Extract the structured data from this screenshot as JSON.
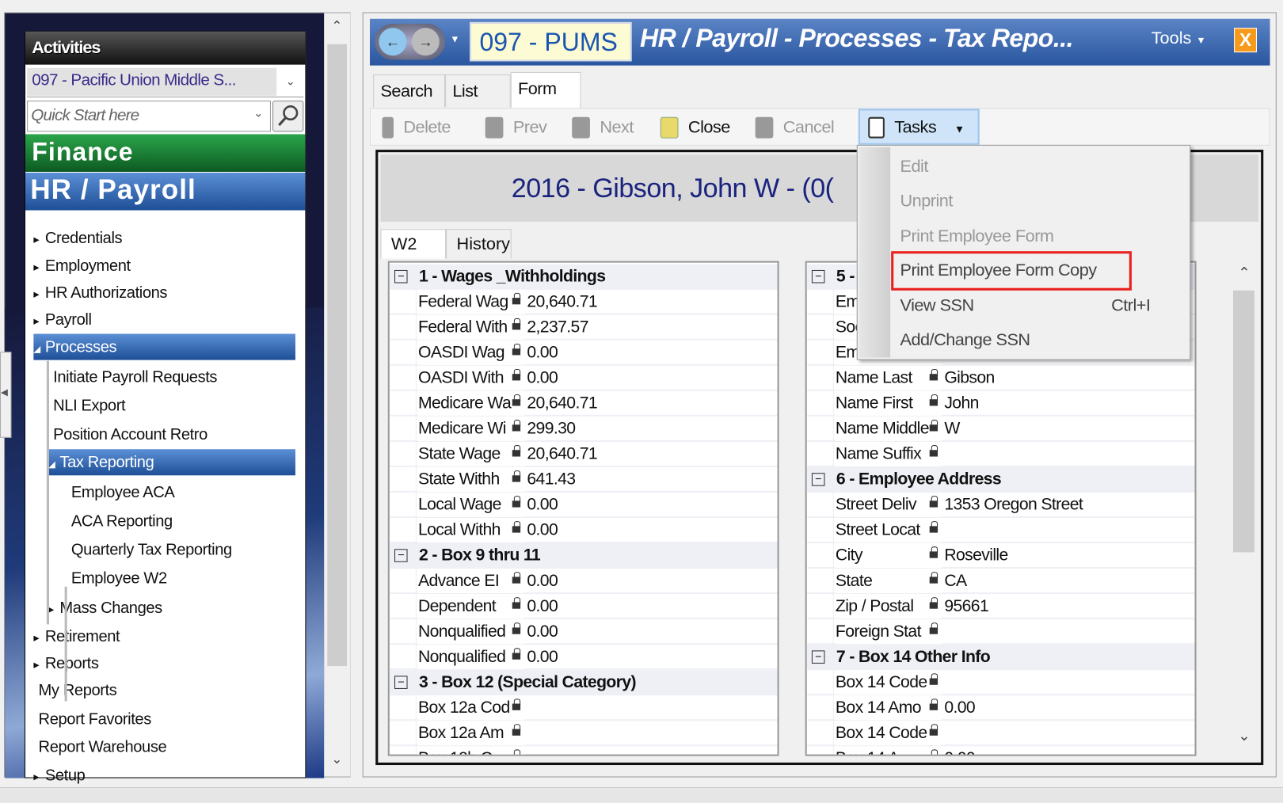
{
  "sidebar": {
    "header": "Activities",
    "district": "097 - Pacific Union Middle S...",
    "quick_start_placeholder": "Quick Start here",
    "modules": {
      "finance": "Finance",
      "hr_payroll": "HR / Payroll"
    },
    "tree": [
      {
        "label": "Credentials",
        "level": 0,
        "arrow": "right"
      },
      {
        "label": "Employment",
        "level": 0,
        "arrow": "right"
      },
      {
        "label": "HR Authorizations",
        "level": 0,
        "arrow": "right"
      },
      {
        "label": "Payroll",
        "level": 0,
        "arrow": "right"
      },
      {
        "label": "Processes",
        "level": 0,
        "arrow": "open",
        "selected": true
      },
      {
        "label": "Initiate Payroll Requests",
        "level": 1
      },
      {
        "label": "NLI Export",
        "level": 1
      },
      {
        "label": "Position Account Retro",
        "level": 1
      },
      {
        "label": "Tax Reporting",
        "level": 1,
        "arrow": "open",
        "selected": true
      },
      {
        "label": "Employee ACA",
        "level": 2
      },
      {
        "label": "ACA Reporting",
        "level": 2
      },
      {
        "label": "Quarterly Tax Reporting",
        "level": 2
      },
      {
        "label": "Employee W2",
        "level": 2
      },
      {
        "label": "Mass Changes",
        "level": 1,
        "arrow": "right"
      },
      {
        "label": "Retirement",
        "level": 0,
        "arrow": "right"
      },
      {
        "label": "Reports",
        "level": 0,
        "arrow": "right"
      },
      {
        "label": "My Reports",
        "level": 0
      },
      {
        "label": "Report Favorites",
        "level": 0
      },
      {
        "label": "Report Warehouse",
        "level": 0
      },
      {
        "label": "Setup",
        "level": 0,
        "arrow": "right"
      }
    ]
  },
  "window": {
    "org_code": "097 - PUMS",
    "title": "HR / Payroll - Processes - Tax Repo...",
    "tools_label": "Tools",
    "close_label": "X",
    "tabs": [
      "Search",
      "List",
      "Form"
    ],
    "active_tab": "Form"
  },
  "toolbar": {
    "delete": "Delete",
    "prev": "Prev",
    "next": "Next",
    "close": "Close",
    "cancel": "Cancel",
    "tasks": "Tasks"
  },
  "form": {
    "title": "2016 - Gibson, John W - (0(",
    "subtabs": [
      "W2",
      "History"
    ],
    "left_grid": [
      {
        "section": "1 - Wages _Withholdings"
      },
      {
        "label": "Federal Wag",
        "value": "20,640.71"
      },
      {
        "label": "Federal With",
        "value": "2,237.57"
      },
      {
        "label": "OASDI Wag",
        "value": "0.00"
      },
      {
        "label": "OASDI With",
        "value": "0.00"
      },
      {
        "label": "Medicare Wa",
        "value": "20,640.71"
      },
      {
        "label": "Medicare Wi",
        "value": "299.30"
      },
      {
        "label": "State Wage",
        "value": "20,640.71"
      },
      {
        "label": "State Withh",
        "value": "641.43"
      },
      {
        "label": "Local Wage",
        "value": "0.00"
      },
      {
        "label": "Local Withh",
        "value": "0.00"
      },
      {
        "section": "2 - Box 9 thru 11"
      },
      {
        "label": "Advance EI",
        "value": "0.00"
      },
      {
        "label": "Dependent",
        "value": "0.00"
      },
      {
        "label": "Nonqualified",
        "value": "0.00"
      },
      {
        "label": "Nonqualified",
        "value": "0.00"
      },
      {
        "section": "3 - Box 12 (Special Category)"
      },
      {
        "label": "Box 12a Cod",
        "value": ""
      },
      {
        "label": "Box 12a Am",
        "value": ""
      },
      {
        "label": "Box 12b C",
        "value": ""
      }
    ],
    "right_grid": [
      {
        "section": "5 -"
      },
      {
        "label": "Em",
        "value": ""
      },
      {
        "label": "Soc",
        "value": ""
      },
      {
        "label": "Em",
        "value": ""
      },
      {
        "label": "Name Last",
        "value": "Gibson"
      },
      {
        "label": "Name First",
        "value": "John"
      },
      {
        "label": "Name Middle",
        "value": "W"
      },
      {
        "label": "Name Suffix",
        "value": ""
      },
      {
        "section": "6 - Employee Address"
      },
      {
        "label": "Street Deliv",
        "value": "1353 Oregon Street"
      },
      {
        "label": "Street Locat",
        "value": ""
      },
      {
        "label": "City",
        "value": "Roseville"
      },
      {
        "label": "State",
        "value": "CA"
      },
      {
        "label": "Zip / Postal",
        "value": "95661"
      },
      {
        "label": "Foreign Stat",
        "value": ""
      },
      {
        "section": "7 - Box 14 Other Info"
      },
      {
        "label": "Box 14 Code",
        "value": ""
      },
      {
        "label": "Box 14 Amo",
        "value": "0.00"
      },
      {
        "label": "Box 14 Code",
        "value": ""
      },
      {
        "label": "Box 14 A",
        "value": "0.00"
      }
    ]
  },
  "tasks_menu": {
    "items": [
      {
        "label": "Edit",
        "disabled": true
      },
      {
        "label": "Unprint",
        "disabled": true
      },
      {
        "label": "Print Employee Form",
        "disabled": true
      },
      {
        "label": "Print Employee Form Copy",
        "highlighted": true
      },
      {
        "label": "View SSN",
        "shortcut": "Ctrl+I"
      },
      {
        "label": "Add/Change SSN"
      }
    ]
  },
  "colors": {
    "highlight_box": "#e8201e",
    "title_bar": "#2a56a0",
    "finance": "#1e8a3a",
    "hr_payroll": "#2f63b0"
  }
}
